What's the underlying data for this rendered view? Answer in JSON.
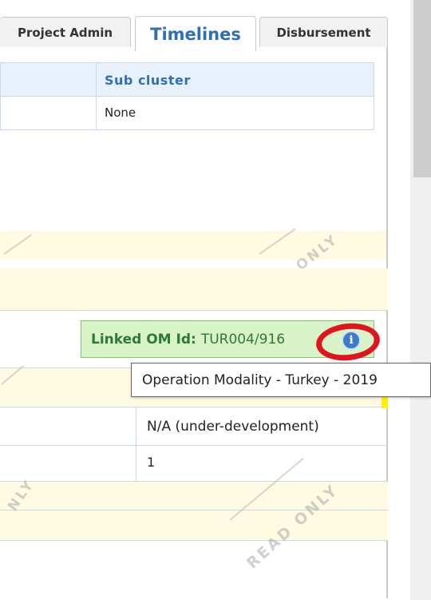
{
  "tabs": [
    {
      "label": "Project Admin",
      "active": false
    },
    {
      "label": "Timelines",
      "active": true
    },
    {
      "label": "Disbursement",
      "active": false
    }
  ],
  "table": {
    "header": "Sub cluster",
    "value": "None"
  },
  "watermark": "READ ONLY",
  "linked_om": {
    "label": "Linked OM Id:",
    "value": "TUR004/916"
  },
  "tooltip": "Operation Modality - Turkey - 2019",
  "rows": [
    {
      "value": "N/A (under-development)"
    },
    {
      "value": "1"
    }
  ],
  "colors": {
    "accent": "#2f6fb5",
    "badge_bg": "#d8f3c8",
    "highlight_ring": "#e0141f",
    "readonly_bg": "#fffbe3"
  },
  "icons": [
    "info-icon"
  ]
}
